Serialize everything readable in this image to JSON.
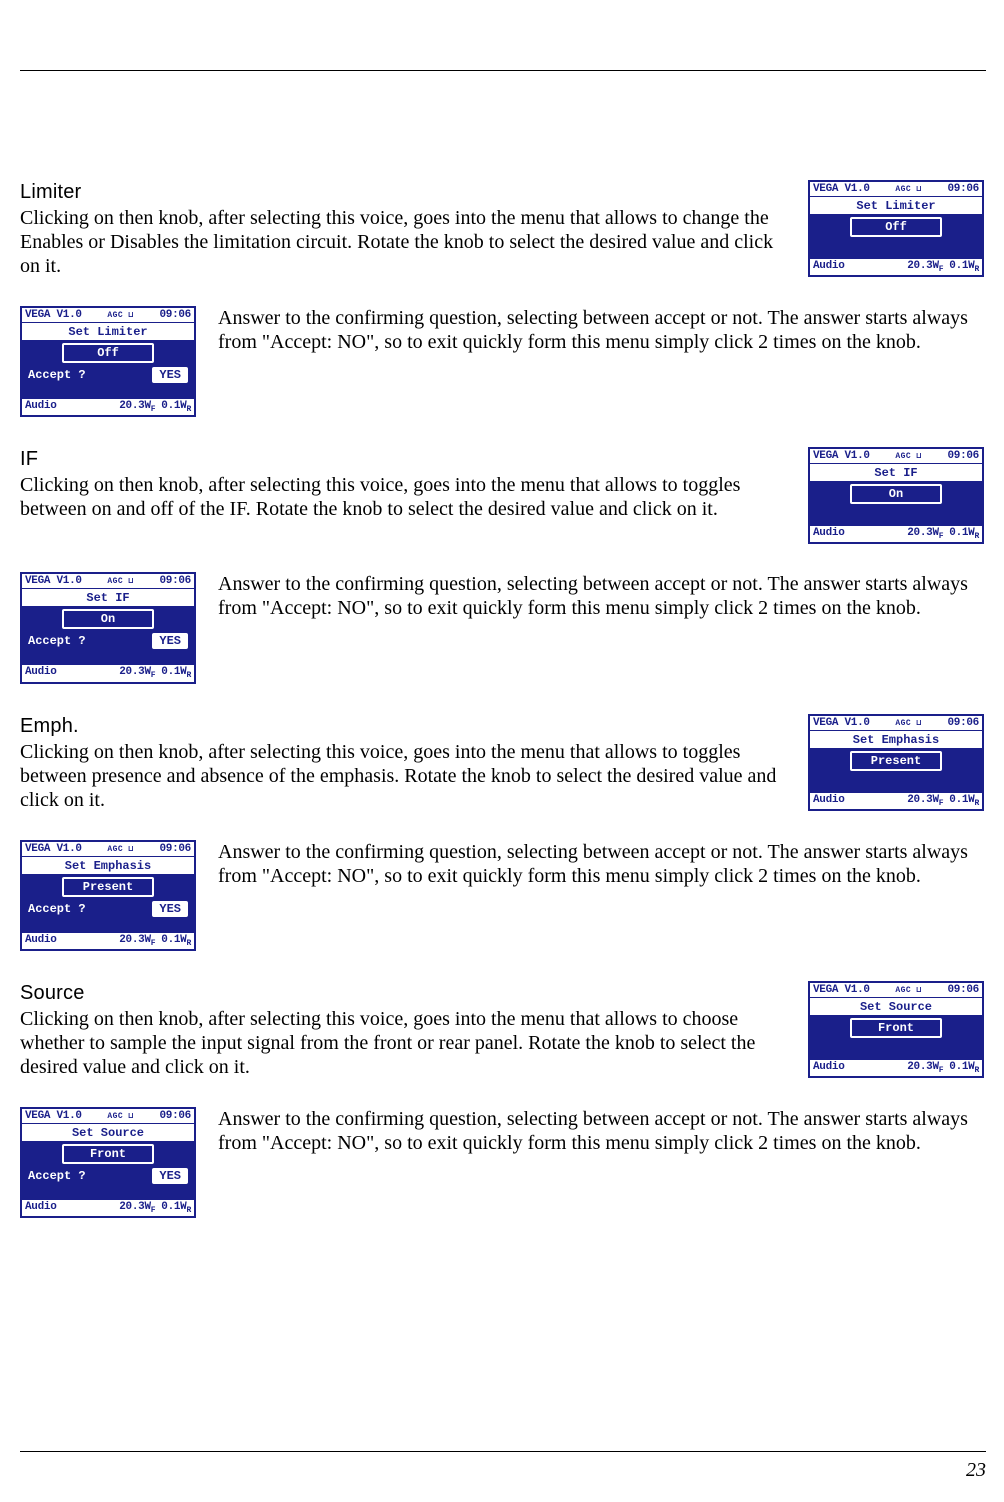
{
  "page_number": "23",
  "common": {
    "device": "VEGA  V1.0",
    "agc": "AGC ⊔",
    "time": "09:06",
    "audio": "Audio",
    "fwd": "20.3W",
    "fwd_sub": "F",
    "ref": "0.1W",
    "ref_sub": "R",
    "accept": "Accept ?",
    "yes": "YES"
  },
  "answer_text": "Answer to the confirming question, selecting between accept or not. The answer starts always from \"Accept: NO\", so to exit quickly form this menu simply click 2 times on the knob.",
  "sections": [
    {
      "heading": "Limiter",
      "intro": "Clicking on then knob, after selecting this voice, goes into the menu that allows to change the Enables or Disables the limitation circuit. Rotate the knob to select the desired value and click on it.",
      "screen_title": "Set  Limiter",
      "value": "Off"
    },
    {
      "heading": "IF",
      "intro": "Clicking on then knob, after selecting this voice, goes into the menu that allows to toggles between on and off of the IF. Rotate the knob to select the desired value and click on it.",
      "screen_title": "Set  IF",
      "value": "On"
    },
    {
      "heading": "Emph.",
      "intro": "Clicking on then knob, after selecting this voice, goes into the menu that allows to toggles between presence and absence of the emphasis. Rotate the knob to select the desired value and click on it.",
      "screen_title": "Set  Emphasis",
      "value": "Present"
    },
    {
      "heading": "Source",
      "intro": "Clicking on then knob, after selecting this voice, goes into the menu that allows to choose whether to sample the input signal from the front or rear panel. Rotate the knob to select the desired value and click on it.",
      "screen_title": "Set  Source",
      "value": "Front"
    }
  ]
}
